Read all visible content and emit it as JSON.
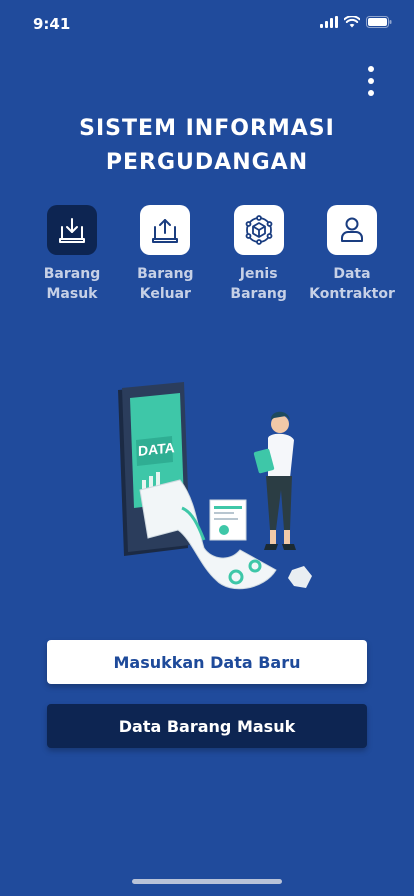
{
  "status": {
    "time": "9:41"
  },
  "title": "SISTEM INFORMASI\nPERGUDANGAN",
  "nav": {
    "items": [
      {
        "label": "Barang\nMasuk",
        "icon": "download-tray-icon",
        "active": true
      },
      {
        "label": "Barang\nKeluar",
        "icon": "upload-tray-icon",
        "active": false
      },
      {
        "label": "Jenis\nBarang",
        "icon": "box-network-icon",
        "active": false
      },
      {
        "label": "Data\nKontraktor",
        "icon": "user-icon",
        "active": false
      }
    ]
  },
  "illustration": {
    "screen_text": "DATA"
  },
  "buttons": {
    "primary": "Masukkan Data Baru",
    "secondary": "Data Barang Masuk"
  },
  "colors": {
    "background": "#204b9c",
    "dark_navy": "#0d2552",
    "accent_teal": "#3ec7a8"
  }
}
